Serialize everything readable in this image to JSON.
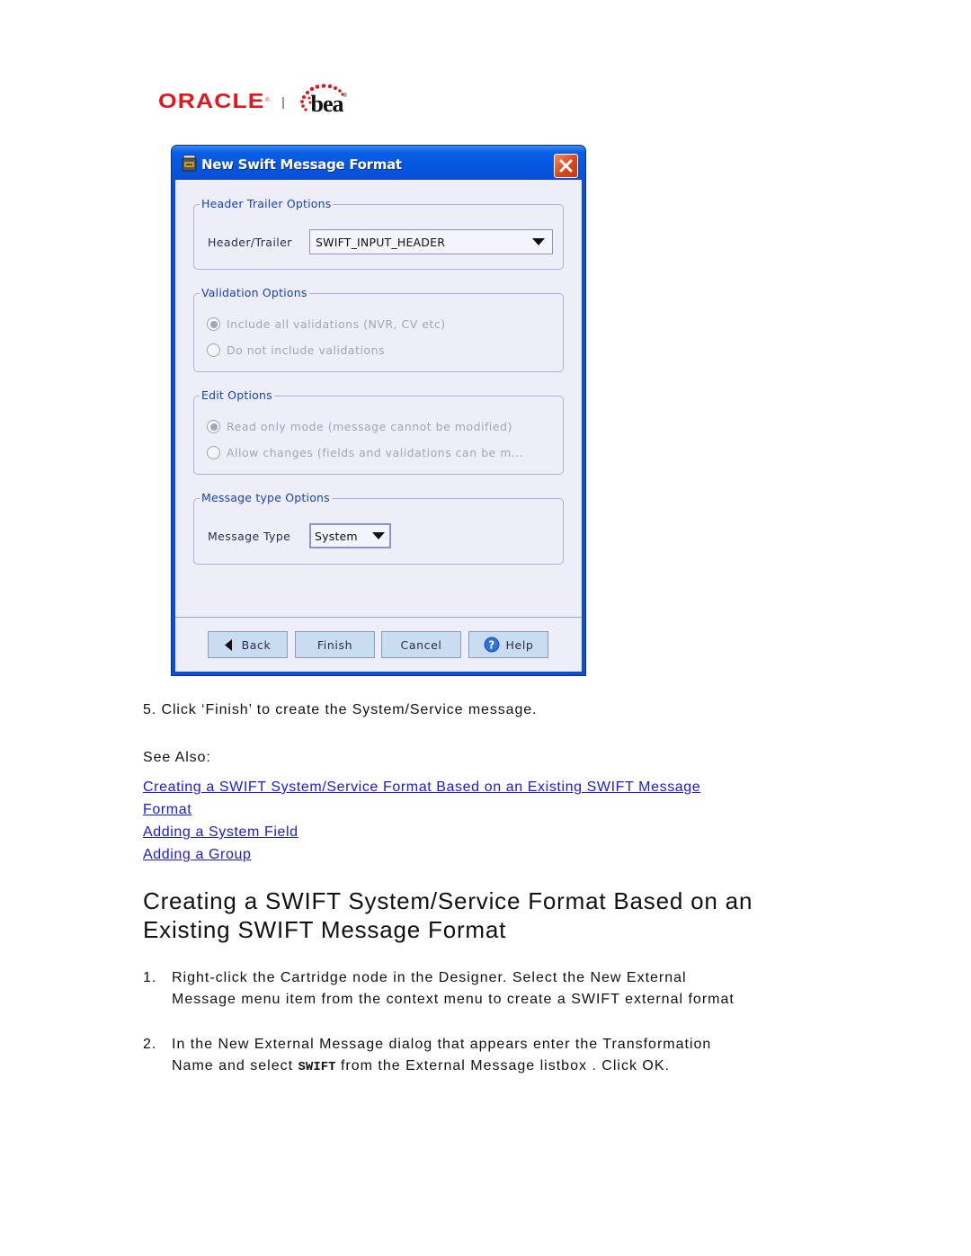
{
  "logo": {
    "oracle": "ORACLE",
    "bea": "bea",
    "registered": "®"
  },
  "dialog": {
    "title": "New Swift Message Format",
    "icon": "jar-icon",
    "groups": {
      "header_trailer": {
        "legend": "Header Trailer Options",
        "label": "Header/Trailer",
        "value": "SWIFT_INPUT_HEADER"
      },
      "validation": {
        "legend": "Validation Options",
        "options": [
          {
            "label": "Include all validations (NVR, CV etc)",
            "selected": true,
            "enabled": false
          },
          {
            "label": "Do not include validations",
            "selected": false,
            "enabled": false
          }
        ]
      },
      "edit": {
        "legend": "Edit Options",
        "options": [
          {
            "label": "Read only mode (message cannot be modified)",
            "selected": true,
            "enabled": false
          },
          {
            "label": "Allow changes (fields and validations can be m...",
            "selected": false,
            "enabled": false
          }
        ]
      },
      "message_type": {
        "legend": "Message type Options",
        "label": "Message Type",
        "value": "System"
      }
    },
    "buttons": {
      "back": "Back",
      "finish": "Finish",
      "cancel": "Cancel",
      "help": "Help"
    }
  },
  "doc": {
    "step5": "5.  Click ‘Finish’ to create the System/Service message.",
    "see_also": "See Also:",
    "links": [
      "Creating a SWIFT System/Service Format Based on an Existing SWIFT Message",
      "Format",
      "Adding a System Field",
      "Adding a Group"
    ],
    "heading_line1": "Creating a SWIFT System/Service Format Based on an",
    "heading_line2": "Existing SWIFT Message Format",
    "steps": [
      {
        "num": "1.",
        "line1": "Right-click the Cartridge node in the Designer. Select the New External",
        "line2": "Message menu item from the context menu to create a SWIFT external format"
      },
      {
        "num": "2.",
        "line1": "In the New External Message dialog that appears enter the Transformation",
        "line2_pre": "Name and select ",
        "line2_code": "SWIFT",
        "line2_post": " from the External Message listbox . Click OK."
      }
    ]
  }
}
